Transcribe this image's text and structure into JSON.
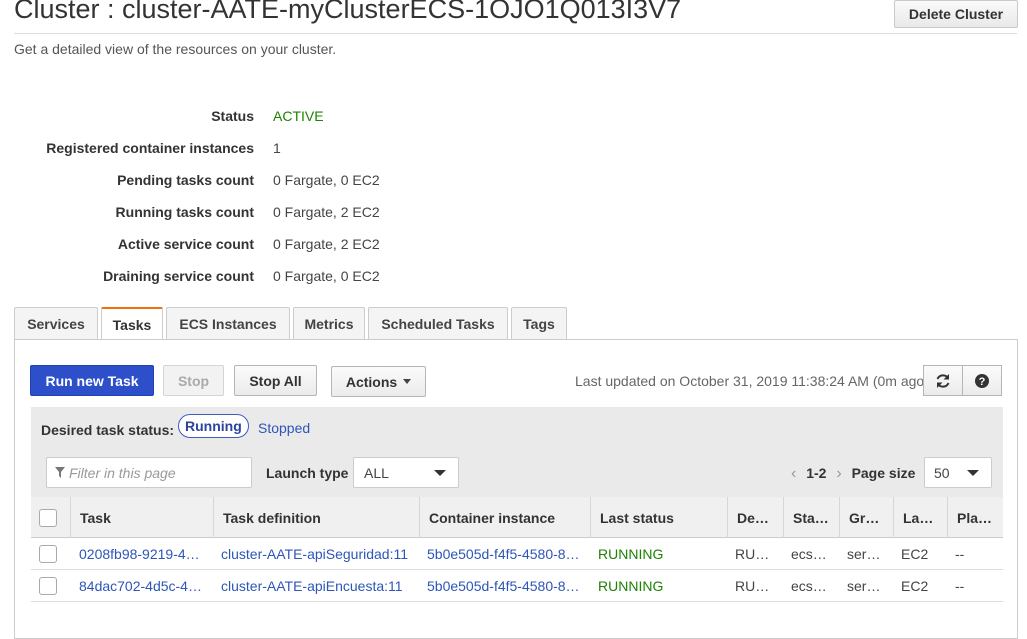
{
  "header": {
    "title": "Cluster : cluster-AATE-myClusterECS-1OJO1Q013I3V7",
    "subtitle": "Get a detailed view of the resources on your cluster.",
    "delete_label": "Delete Cluster"
  },
  "details": [
    {
      "label": "Status",
      "value": "ACTIVE"
    },
    {
      "label": "Registered container instances",
      "value": "1"
    },
    {
      "label": "Pending tasks count",
      "value": "0 Fargate, 0 EC2"
    },
    {
      "label": "Running tasks count",
      "value": "0 Fargate, 2 EC2"
    },
    {
      "label": "Active service count",
      "value": "0 Fargate, 2 EC2"
    },
    {
      "label": "Draining service count",
      "value": "0 Fargate, 0 EC2"
    }
  ],
  "tabs": [
    "Services",
    "Tasks",
    "ECS Instances",
    "Metrics",
    "Scheduled Tasks",
    "Tags"
  ],
  "active_tab": "Tasks",
  "toolbar": {
    "run_label": "Run new Task",
    "stop_label": "Stop",
    "stop_all_label": "Stop All",
    "actions_label": "Actions",
    "updated_text": "Last updated on October 31, 2019 11:38:24 AM (0m ago)"
  },
  "filters": {
    "desired_label": "Desired task status:",
    "running_label": "Running",
    "stopped_label": "Stopped",
    "filter_placeholder": "Filter in this page",
    "launch_label": "Launch type",
    "launch_value": "ALL",
    "page_range": "1-2",
    "page_size_label": "Page size",
    "page_size_value": "50"
  },
  "table": {
    "columns": [
      "Task",
      "Task definition",
      "Container instance",
      "Last status",
      "De…",
      "Sta…",
      "Gr…",
      "La…",
      "Pla…"
    ],
    "rows": [
      [
        "0208fb98-9219-4…",
        "cluster-AATE-apiSeguridad:11",
        "5b0e505d-f4f5-4580-8…",
        "RUNNING",
        "RU…",
        "ecs…",
        "ser…",
        "EC2",
        "--"
      ],
      [
        "84dac702-4d5c-4…",
        "cluster-AATE-apiEncuesta:11",
        "5b0e505d-f4f5-4580-8…",
        "RUNNING",
        "RU…",
        "ecs…",
        "ser…",
        "EC2",
        "--"
      ]
    ]
  },
  "colors": {
    "accent": "#2d4fc9",
    "active_tab": "#ec7211",
    "running": "#1d8102",
    "link": "#2e55b8"
  },
  "icons": {
    "refresh": "refresh-icon",
    "help": "help-icon",
    "filter": "filter-icon"
  }
}
